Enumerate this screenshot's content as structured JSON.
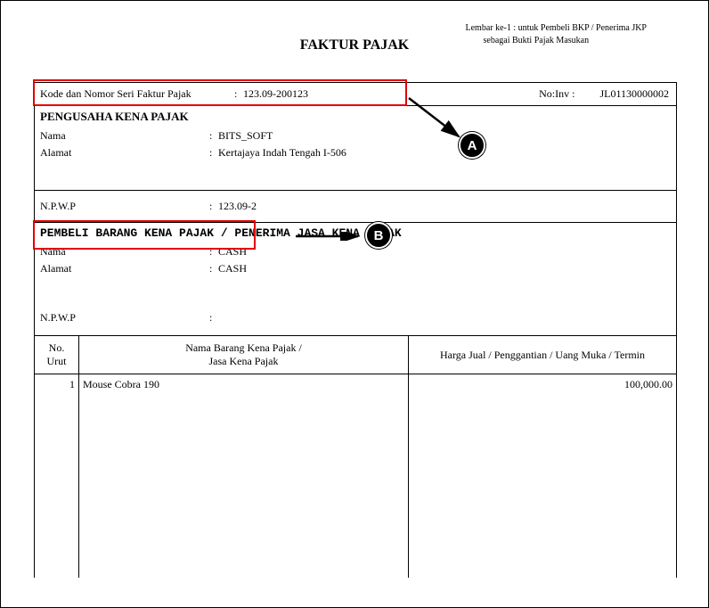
{
  "header": {
    "line1": "Lembar ke-1 : untuk Pembeli BKP / Penerima JKP",
    "line2": "sebagai Bukti Pajak Masukan"
  },
  "title": "FAKTUR PAJAK",
  "kode": {
    "label": "Kode dan Nomor Seri Faktur Pajak",
    "value": "123.09-200123",
    "noinv_label": "No:Inv :",
    "noinv_value": "JL01130000002"
  },
  "pkp": {
    "title": "PENGUSAHA KENA PAJAK",
    "nama_label": "Nama",
    "nama_value": "BITS_SOFT",
    "alamat_label": "Alamat",
    "alamat_value": "Kertajaya Indah Tengah I-506"
  },
  "npwp": {
    "label": "N.P.W.P",
    "value": "123.09-2"
  },
  "pembeli": {
    "title": "PEMBELI BARANG KENA PAJAK / PENERIMA JASA KENA PAJAK",
    "nama_label": "Nama",
    "nama_value": "CASH",
    "alamat_label": "Alamat",
    "alamat_value": "CASH",
    "npwp_label": "N.P.W.P",
    "npwp_value": ""
  },
  "table": {
    "head_no_line1": "No.",
    "head_no_line2": "Urut",
    "head_barang_line1": "Nama Barang Kena Pajak /",
    "head_barang_line2": "Jasa Kena Pajak",
    "head_harga": "Harga Jual / Penggantian / Uang Muka / Termin",
    "row1_no": "1",
    "row1_barang": "Mouse Cobra 190",
    "row1_harga": "100,000.00"
  },
  "annotations": {
    "a": "A",
    "b": "B"
  }
}
